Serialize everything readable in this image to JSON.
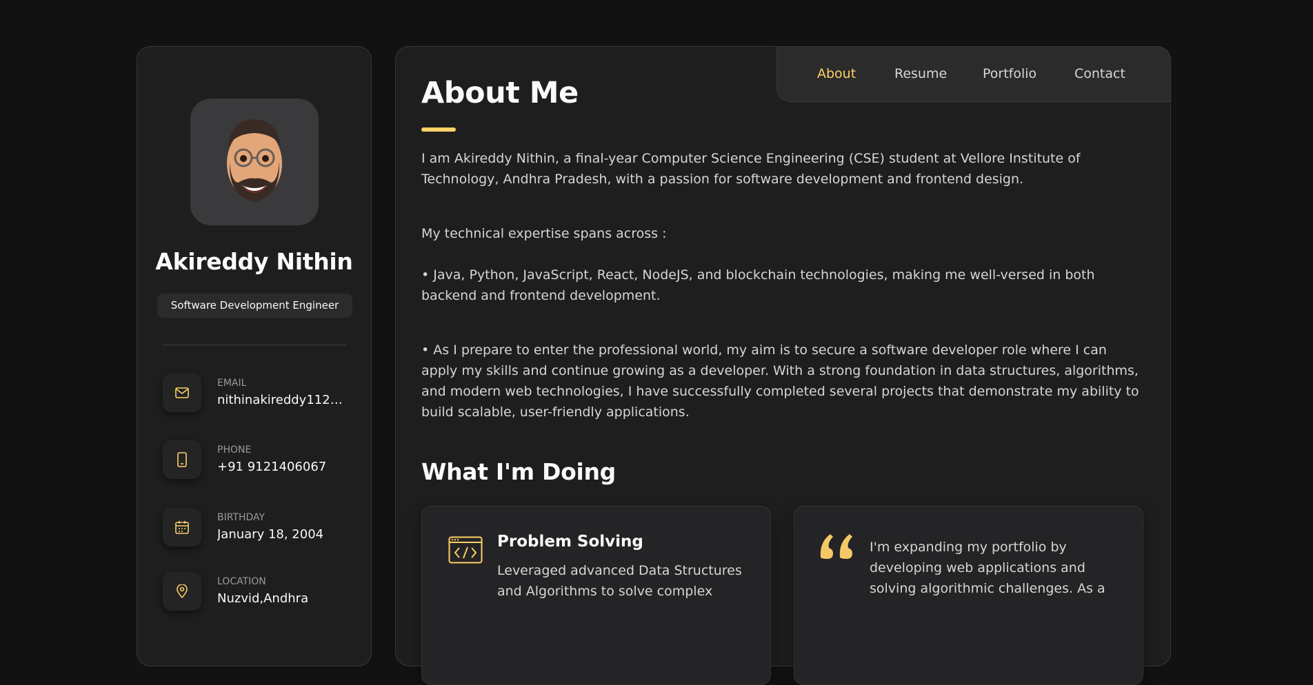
{
  "colors": {
    "accent": "#ffd166",
    "background": "#121212",
    "card": "#1e1e1f"
  },
  "profile": {
    "name": "Akireddy Nithin",
    "title": "Software Development Engineer",
    "avatar_icon": "memoji-avatar"
  },
  "contacts": [
    {
      "label": "EMAIL",
      "value": "nithinakireddy112@g...",
      "icon": "mail-icon"
    },
    {
      "label": "PHONE",
      "value": "+91 9121406067",
      "icon": "phone-icon"
    },
    {
      "label": "BIRTHDAY",
      "value": "January 18, 2004",
      "icon": "calendar-icon"
    },
    {
      "label": "LOCATION",
      "value": "Nuzvid,Andhra",
      "icon": "location-icon"
    }
  ],
  "nav": {
    "items": [
      {
        "label": "About",
        "active": true
      },
      {
        "label": "Resume",
        "active": false
      },
      {
        "label": "Portfolio",
        "active": false
      },
      {
        "label": "Contact",
        "active": false
      }
    ]
  },
  "about": {
    "title": "About Me",
    "paragraphs": [
      "I am Akireddy Nithin, a final-year Computer Science Engineering (CSE) student at Vellore Institute of Technology, Andhra Pradesh, with a passion for software development and frontend design.",
      "My technical expertise spans across :",
      "• Java, Python, JavaScript, React, NodeJS, and blockchain technologies, making me well-versed in both backend and frontend development.",
      "• As I prepare to enter the professional world, my aim is to secure a software developer role where I can apply my skills and continue growing as a developer. With a strong foundation in data structures, algorithms, and modern web technologies, I have successfully completed several projects that demonstrate my ability to build scalable, user-friendly applications."
    ]
  },
  "doing": {
    "title": "What I'm Doing",
    "cards": [
      {
        "title": "Problem Solving",
        "text": "Leveraged advanced Data Structures and Algorithms to solve complex",
        "icon": "code-window-icon"
      },
      {
        "quote": "I'm expanding my portfolio by developing web applications and solving algorithmic challenges. As a",
        "icon": "quote-icon"
      }
    ]
  }
}
